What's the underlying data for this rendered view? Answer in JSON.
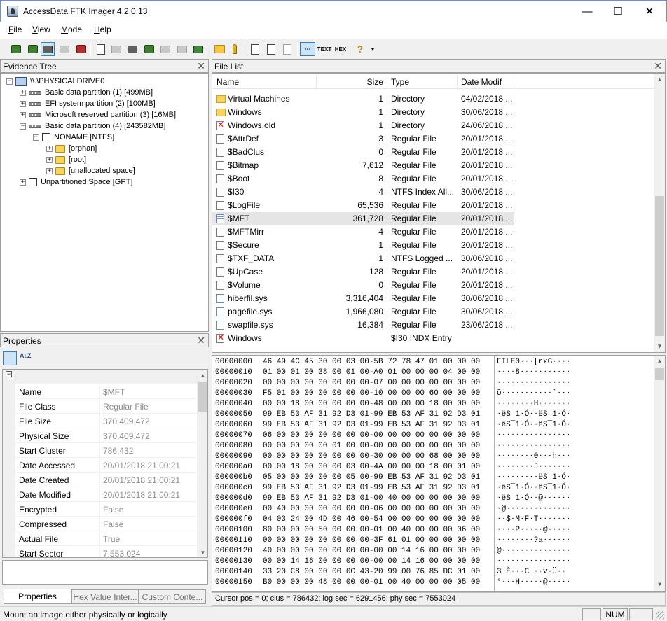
{
  "window": {
    "title": "AccessData FTK Imager 4.2.0.13",
    "minimize": "—",
    "maximize": "☐",
    "close": "✕"
  },
  "menu": {
    "file": {
      "hot": "F",
      "rest": "ile"
    },
    "view": {
      "hot": "V",
      "rest": "iew"
    },
    "mode": {
      "hot": "M",
      "rest": "ode"
    },
    "help": {
      "hot": "H",
      "rest": "elp"
    }
  },
  "toolbar": {
    "text_view": "TEXT",
    "hex_view": "HEX",
    "help_icon": "?",
    "more": "▾"
  },
  "evidence_tree": {
    "title": "Evidence Tree",
    "close": "✕",
    "nodes": [
      {
        "label": "\\\\.\\PHYSICALDRIVE0",
        "exp": "−"
      },
      {
        "label": "Basic data partition (1) [499MB]",
        "exp": "+"
      },
      {
        "label": "EFI system partition (2) [100MB]",
        "exp": "+"
      },
      {
        "label": "Microsoft reserved partition (3) [16MB]",
        "exp": "+"
      },
      {
        "label": "Basic data partition (4) [243582MB]",
        "exp": "−"
      },
      {
        "label": "NONAME [NTFS]",
        "exp": "−"
      },
      {
        "label": "[orphan]",
        "exp": "+"
      },
      {
        "label": "[root]",
        "exp": "+"
      },
      {
        "label": "[unallocated space]",
        "exp": "+"
      },
      {
        "label": "Unpartitioned Space [GPT]",
        "exp": "+"
      }
    ]
  },
  "file_list": {
    "title": "File List",
    "close": "✕",
    "columns": [
      "Name",
      "Size",
      "Type",
      "Date Modif"
    ],
    "rows": [
      {
        "icon": "folder",
        "name": "Virtual Machines",
        "size": "1",
        "type": "Directory",
        "date": "04/02/2018 ..."
      },
      {
        "icon": "folder",
        "name": "Windows",
        "size": "1",
        "type": "Directory",
        "date": "30/06/2018 ..."
      },
      {
        "icon": "deleted",
        "name": "Windows.old",
        "size": "1",
        "type": "Directory",
        "date": "24/06/2018 ..."
      },
      {
        "icon": "file",
        "name": "$AttrDef",
        "size": "3",
        "type": "Regular File",
        "date": "20/01/2018 ..."
      },
      {
        "icon": "file",
        "name": "$BadClus",
        "size": "0",
        "type": "Regular File",
        "date": "20/01/2018 ..."
      },
      {
        "icon": "file",
        "name": "$Bitmap",
        "size": "7,612",
        "type": "Regular File",
        "date": "20/01/2018 ..."
      },
      {
        "icon": "file",
        "name": "$Boot",
        "size": "8",
        "type": "Regular File",
        "date": "20/01/2018 ..."
      },
      {
        "icon": "file",
        "name": "$I30",
        "size": "4",
        "type": "NTFS Index All...",
        "date": "30/06/2018 ..."
      },
      {
        "icon": "file",
        "name": "$LogFile",
        "size": "65,536",
        "type": "Regular File",
        "date": "20/01/2018 ..."
      },
      {
        "icon": "grid",
        "name": "$MFT",
        "size": "361,728",
        "type": "Regular File",
        "date": "20/01/2018 ..."
      },
      {
        "icon": "file",
        "name": "$MFTMirr",
        "size": "4",
        "type": "Regular File",
        "date": "20/01/2018 ..."
      },
      {
        "icon": "file",
        "name": "$Secure",
        "size": "1",
        "type": "Regular File",
        "date": "20/01/2018 ..."
      },
      {
        "icon": "file",
        "name": "$TXF_DATA",
        "size": "1",
        "type": "NTFS Logged ...",
        "date": "30/06/2018 ..."
      },
      {
        "icon": "file",
        "name": "$UpCase",
        "size": "128",
        "type": "Regular File",
        "date": "20/01/2018 ..."
      },
      {
        "icon": "file",
        "name": "$Volume",
        "size": "0",
        "type": "Regular File",
        "date": "20/01/2018 ..."
      },
      {
        "icon": "sys",
        "name": "hiberfil.sys",
        "size": "3,316,404",
        "type": "Regular File",
        "date": "30/06/2018 ..."
      },
      {
        "icon": "sys",
        "name": "pagefile.sys",
        "size": "1,966,080",
        "type": "Regular File",
        "date": "30/06/2018 ..."
      },
      {
        "icon": "sys",
        "name": "swapfile.sys",
        "size": "16,384",
        "type": "Regular File",
        "date": "23/06/2018 ..."
      },
      {
        "icon": "deleted",
        "name": "Windows",
        "size": "",
        "type": "$I30 INDX Entry",
        "date": ""
      }
    ]
  },
  "properties": {
    "title": "Properties",
    "close": "✕",
    "collapse": "−",
    "sort_icon": "A↓Z",
    "rows": [
      {
        "key": "Name",
        "value": "$MFT"
      },
      {
        "key": "File Class",
        "value": "Regular File"
      },
      {
        "key": "File Size",
        "value": "370,409,472"
      },
      {
        "key": "Physical Size",
        "value": "370,409,472"
      },
      {
        "key": "Start Cluster",
        "value": "786,432"
      },
      {
        "key": "Date Accessed",
        "value": "20/01/2018 21:00:21"
      },
      {
        "key": "Date Created",
        "value": "20/01/2018 21:00:21"
      },
      {
        "key": "Date Modified",
        "value": "20/01/2018 21:00:21"
      },
      {
        "key": "Encrypted",
        "value": "False"
      },
      {
        "key": "Compressed",
        "value": "False"
      },
      {
        "key": "Actual File",
        "value": "True"
      },
      {
        "key": "Start Sector",
        "value": "7,553,024"
      }
    ],
    "tabs": [
      "Properties",
      "Hex Value Inter...",
      "Custom Conte..."
    ]
  },
  "hex": {
    "rows": [
      {
        "off": "00000000",
        "bytes": "46 49 4C 45 30 00 03 00-5B 72 78 47 01 00 00 00",
        "ascii": "FILE0···[rxG····"
      },
      {
        "off": "00000010",
        "bytes": "01 00 01 00 38 00 01 00-A0 01 00 00 00 04 00 00",
        "ascii": "····8···········"
      },
      {
        "off": "00000020",
        "bytes": "00 00 00 00 00 00 00 00-07 00 00 00 00 00 00 00",
        "ascii": "················"
      },
      {
        "off": "00000030",
        "bytes": "F5 01 00 00 00 00 00 00-10 00 00 00 60 00 00 00",
        "ascii": "õ···········`···"
      },
      {
        "off": "00000040",
        "bytes": "00 00 18 00 00 00 00 00-48 00 00 00 18 00 00 00",
        "ascii": "········H·······"
      },
      {
        "off": "00000050",
        "bytes": "99 EB 53 AF 31 92 D3 01-99 EB 53 AF 31 92 D3 01",
        "ascii": "·ëS¯1·Ó··ëS¯1·Ó·"
      },
      {
        "off": "00000060",
        "bytes": "99 EB 53 AF 31 92 D3 01-99 EB 53 AF 31 92 D3 01",
        "ascii": "·ëS¯1·Ó··ëS¯1·Ó·"
      },
      {
        "off": "00000070",
        "bytes": "06 00 00 00 00 00 00 00-00 00 00 00 00 00 00 00",
        "ascii": "················"
      },
      {
        "off": "00000080",
        "bytes": "00 00 00 00 00 01 00 00-00 00 00 00 00 00 00 00",
        "ascii": "················"
      },
      {
        "off": "00000090",
        "bytes": "00 00 00 00 00 00 00 00-30 00 00 00 68 00 00 00",
        "ascii": "········0···h···"
      },
      {
        "off": "000000a0",
        "bytes": "00 00 18 00 00 00 03 00-4A 00 00 00 18 00 01 00",
        "ascii": "········J·······"
      },
      {
        "off": "000000b0",
        "bytes": "05 00 00 00 00 00 05 00-99 EB 53 AF 31 92 D3 01",
        "ascii": "·········ëS¯1·Ó·"
      },
      {
        "off": "000000c0",
        "bytes": "99 EB 53 AF 31 92 D3 01-99 EB 53 AF 31 92 D3 01",
        "ascii": "·ëS¯1·Ó··ëS¯1·Ó·"
      },
      {
        "off": "000000d0",
        "bytes": "99 EB 53 AF 31 92 D3 01-00 40 00 00 00 00 00 00",
        "ascii": "·ëS¯1·Ó··@······"
      },
      {
        "off": "000000e0",
        "bytes": "00 40 00 00 00 00 00 00-06 00 00 00 00 00 00 00",
        "ascii": "·@··············"
      },
      {
        "off": "000000f0",
        "bytes": "04 03 24 00 4D 00 46 00-54 00 00 00 00 00 00 00",
        "ascii": "··$·M·F·T·······"
      },
      {
        "off": "00000100",
        "bytes": "80 00 00 00 50 00 00 00-01 00 40 00 00 00 06 00",
        "ascii": "····P·····@·····"
      },
      {
        "off": "00000110",
        "bytes": "00 00 00 00 00 00 00 00-3F 61 01 00 00 00 00 00",
        "ascii": "········?a······"
      },
      {
        "off": "00000120",
        "bytes": "40 00 00 00 00 00 00 00-00 00 14 16 00 00 00 00",
        "ascii": "@···············"
      },
      {
        "off": "00000130",
        "bytes": "00 00 14 16 00 00 00 00-00 00 14 16 00 00 00 00",
        "ascii": "················"
      },
      {
        "off": "00000140",
        "bytes": "33 20 C8 00 00 00 0C 43-20 99 00 76 85 DC 01 00",
        "ascii": "3 È···C ··v·Ü··"
      },
      {
        "off": "00000150",
        "bytes": "B0 00 00 00 48 00 00 00-01 00 40 00 00 00 05 00",
        "ascii": "°···H·····@·····"
      }
    ],
    "cursor_status": "Cursor pos = 0; clus = 786432; log sec = 6291456; phy sec = 7553024"
  },
  "status": {
    "message": "Mount an image either physically or logically",
    "num": "NUM"
  },
  "colors": {
    "title_border": "#6b8fd0",
    "selection": "#e5e5e5",
    "toolbar_active": "#cde4f7"
  }
}
